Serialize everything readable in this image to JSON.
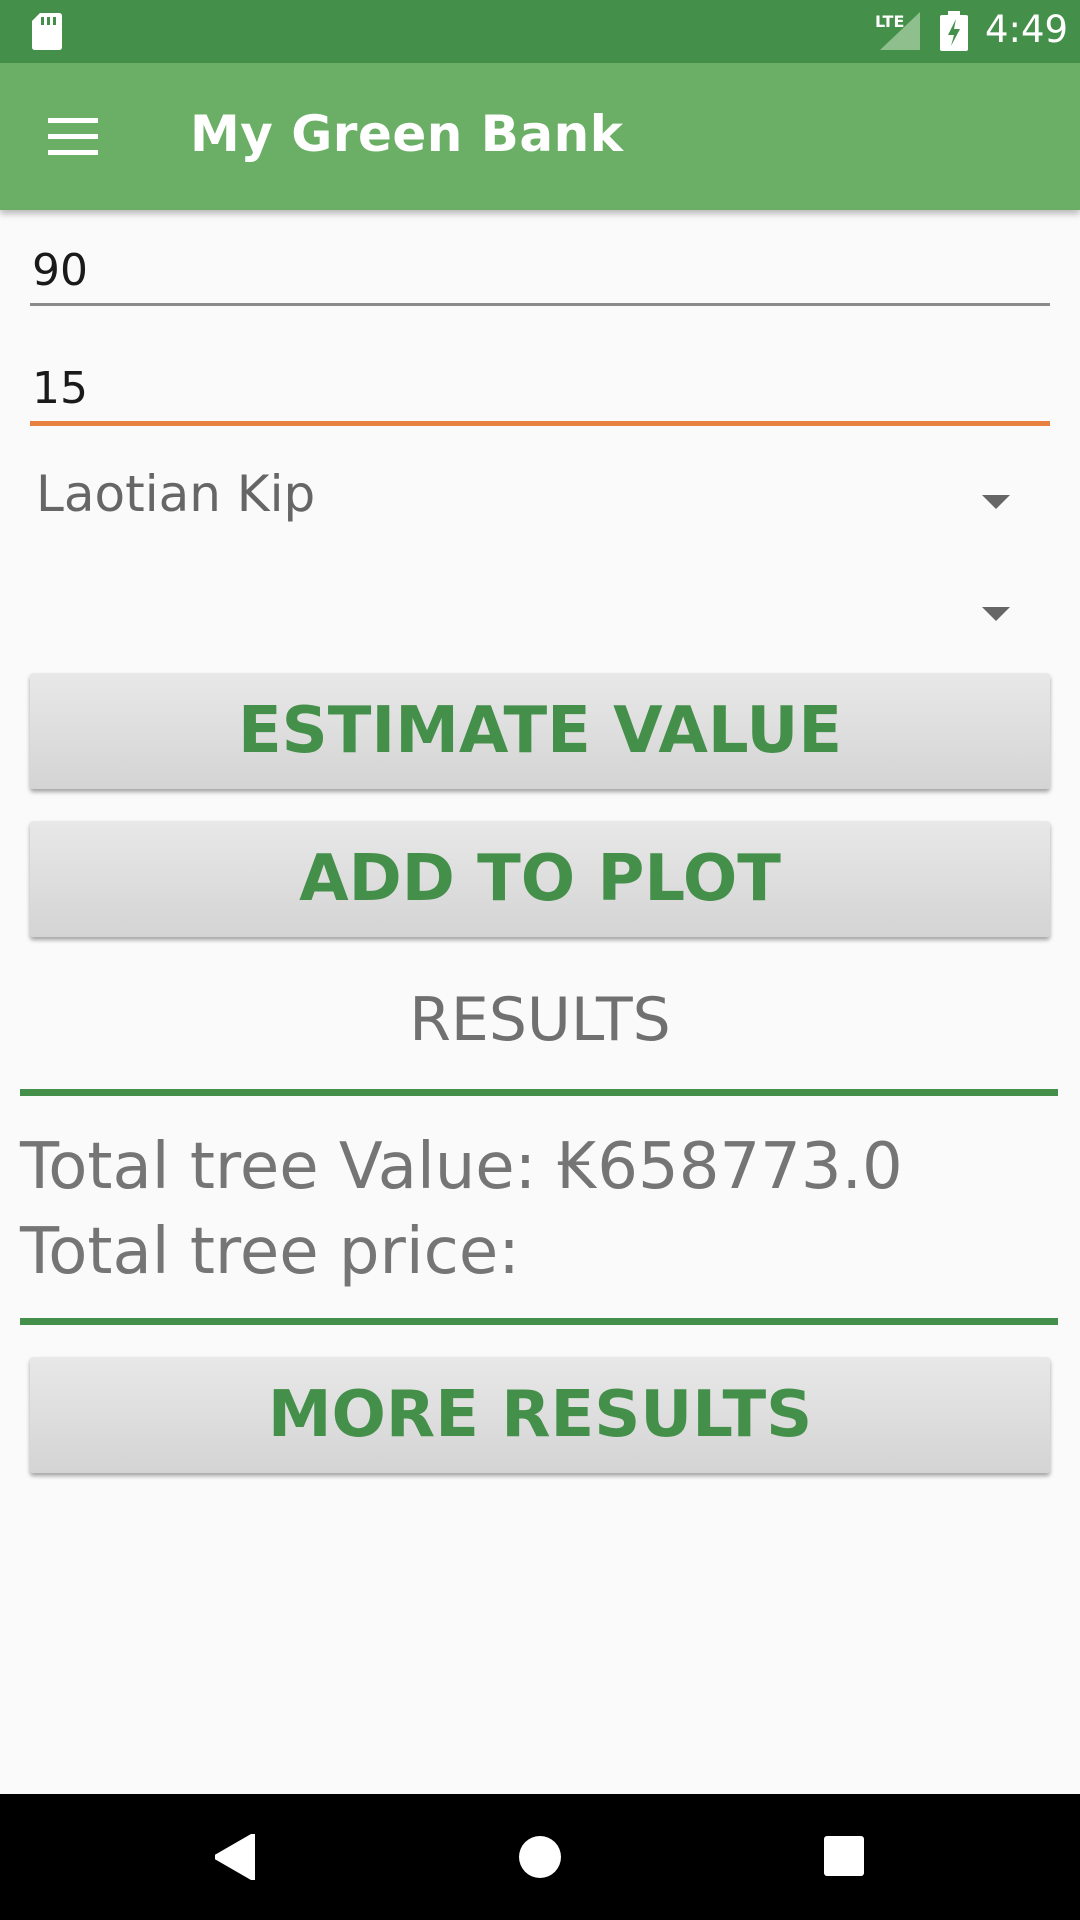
{
  "status_bar": {
    "time": "4:49",
    "network": "LTE",
    "icons": [
      "sd-card-icon",
      "signal-icon",
      "battery-charging-icon"
    ]
  },
  "app_bar": {
    "title": "My Green Bank",
    "menu_icon": "menu-icon"
  },
  "form": {
    "field1_value": "90",
    "field2_value": "15",
    "currency_select": "Laotian Kip",
    "second_select": ""
  },
  "buttons": {
    "estimate": "ESTIMATE VALUE",
    "add_to_plot": "ADD TO PLOT",
    "more_results": "MORE RESULTS"
  },
  "results": {
    "title": "RESULTS",
    "total_value": "Total tree Value: ₭658773.0",
    "total_price": "Total tree price:"
  },
  "nav_bar": {
    "icons": [
      "back-icon",
      "home-icon",
      "recents-icon"
    ]
  },
  "colors": {
    "status_bar": "#44904a",
    "app_bar": "#6aaf65",
    "accent": "#44904a",
    "focus_underline": "#e8813f"
  }
}
